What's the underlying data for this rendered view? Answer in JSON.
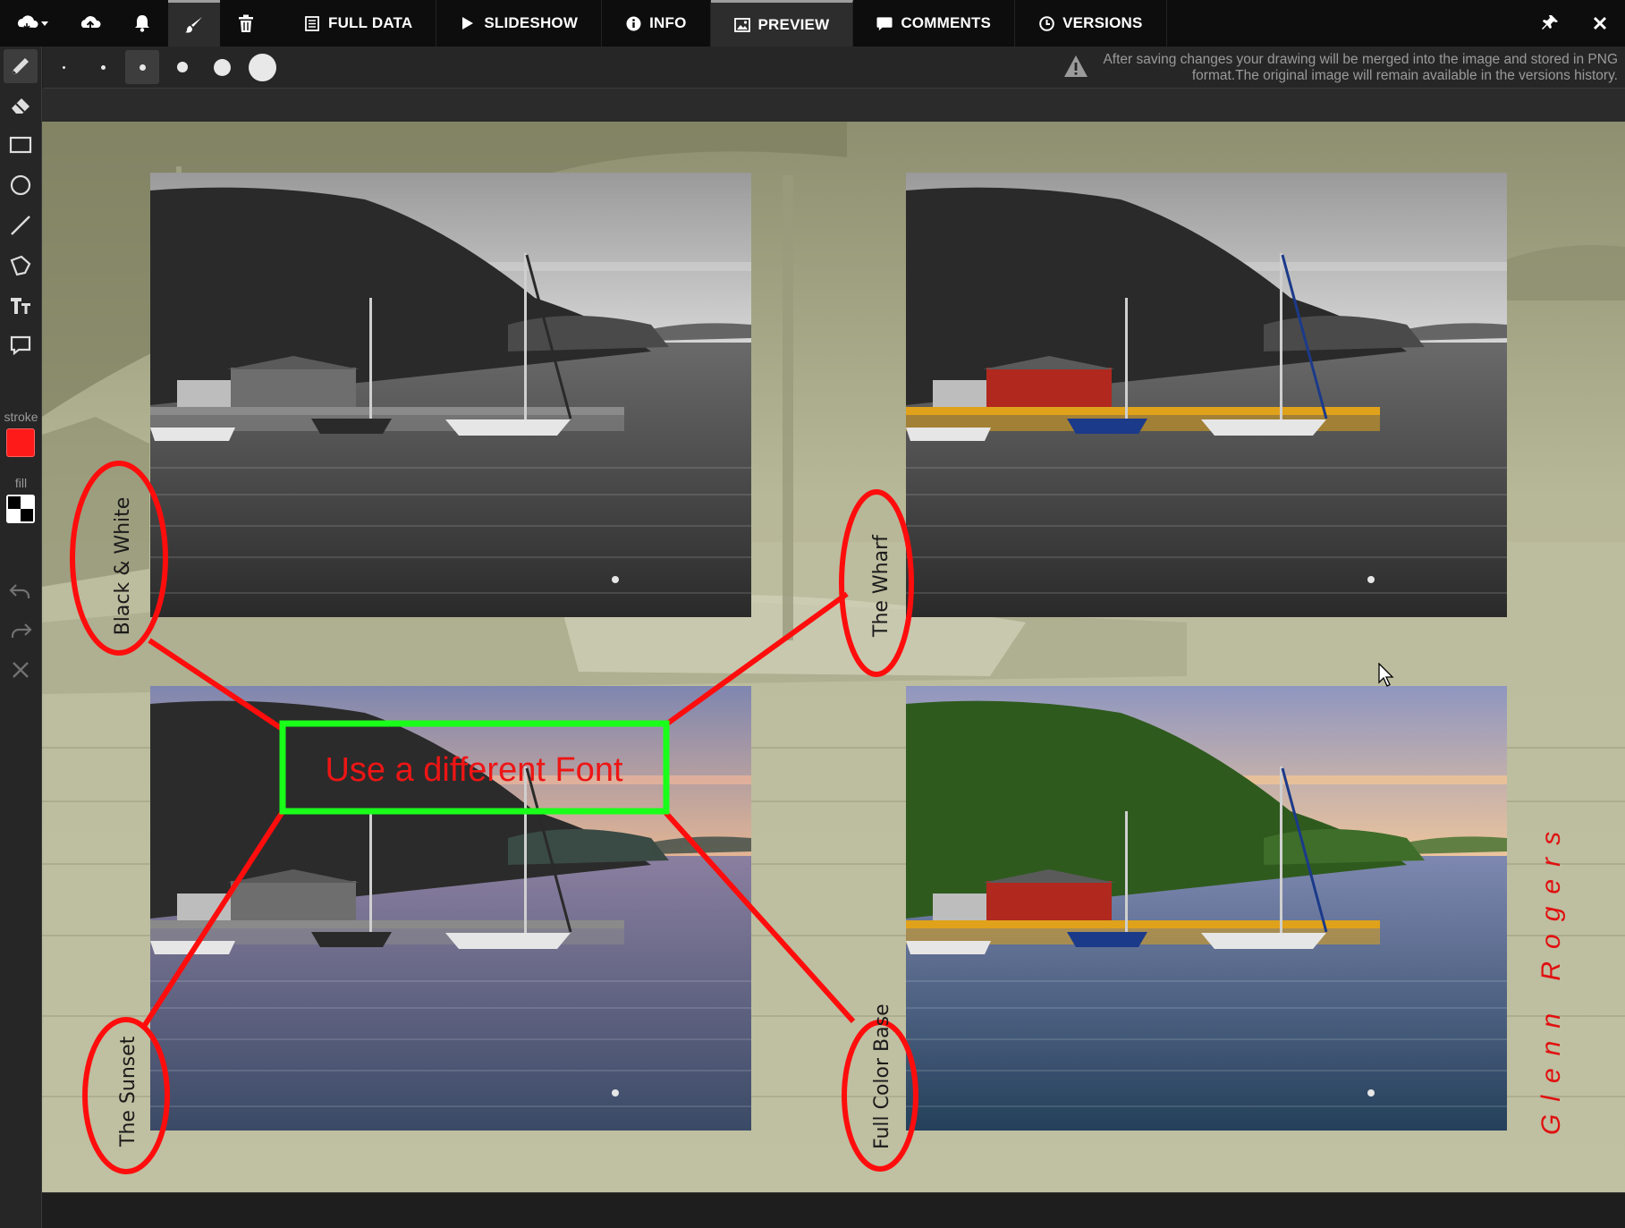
{
  "toolbar": {
    "tabs": [
      {
        "label": "FULL DATA",
        "icon": "list-icon"
      },
      {
        "label": "SLIDESHOW",
        "icon": "play-icon"
      },
      {
        "label": "INFO",
        "icon": "info-icon"
      },
      {
        "label": "PREVIEW",
        "icon": "image-icon"
      },
      {
        "label": "COMMENTS",
        "icon": "comment-icon"
      },
      {
        "label": "VERSIONS",
        "icon": "clock-icon"
      }
    ],
    "active_tab": "PREVIEW",
    "left_icons": [
      "cloud-menu-icon",
      "upload-icon",
      "bell-icon",
      "brush-icon",
      "trash-icon"
    ],
    "right_icons": [
      "pin-icon",
      "close-icon"
    ]
  },
  "brush_sizes": {
    "options": [
      1,
      2,
      3,
      4,
      5,
      6
    ],
    "selected": 3
  },
  "notice": {
    "icon": "warning-icon",
    "text": "After saving changes your drawing will be merged into the image and stored in PNG format.The original image will remain available in the versions history."
  },
  "tools": {
    "items": [
      "pencil-icon",
      "eraser-icon",
      "rectangle-icon",
      "circle-icon",
      "line-icon",
      "polygon-icon",
      "text-icon",
      "comment-box-icon"
    ],
    "selected": "pencil-icon",
    "stroke_label": "stroke",
    "stroke_color": "#ff1a1a",
    "fill_label": "fill",
    "history": [
      "undo-icon",
      "redo-icon",
      "clear-icon"
    ]
  },
  "artwork": {
    "annotation_text": "Use a different Font",
    "labels": {
      "top_left": "Black & White",
      "top_right": "The Wharf",
      "bottom_left": "The Sunset",
      "bottom_right": "Full Color Base"
    },
    "signature": "Glenn Rogers",
    "annotation_stroke": "#ff0d0d",
    "box_stroke": "#1aff1a"
  }
}
